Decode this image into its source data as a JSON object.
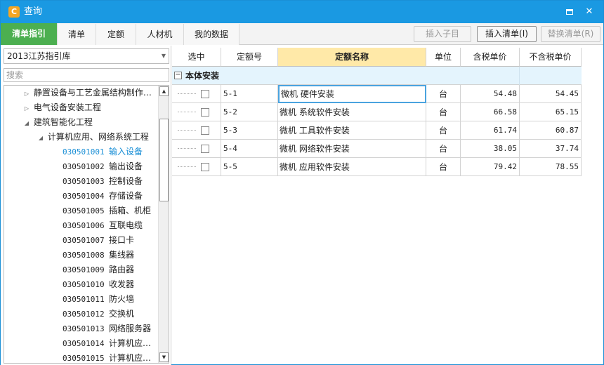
{
  "window": {
    "title": "查询",
    "app_icon_glyph": "C"
  },
  "tabs": [
    {
      "label": "清单指引",
      "active": true
    },
    {
      "label": "清单",
      "active": false
    },
    {
      "label": "定额",
      "active": false
    },
    {
      "label": "人材机",
      "active": false
    },
    {
      "label": "我的数据",
      "active": false
    }
  ],
  "toolbar": {
    "insert_child": "插入子目",
    "insert_list": "插入清单(I)",
    "replace_list": "替换清单(R)"
  },
  "left": {
    "library": "2013江苏指引库",
    "search_placeholder": "搜索",
    "tree": [
      {
        "arrow": "▷",
        "code": "",
        "label": "静置设备与工艺金属结构制作…",
        "selected": false
      },
      {
        "arrow": "▷",
        "code": "",
        "label": "电气设备安装工程",
        "selected": false
      },
      {
        "arrow": "◢",
        "code": "",
        "label": "建筑智能化工程",
        "selected": false
      },
      {
        "arrow": "◢",
        "code": "",
        "label": "计算机应用、网络系统工程",
        "selected": false
      },
      {
        "arrow": "",
        "code": "030501001",
        "label": "输入设备",
        "selected": true
      },
      {
        "arrow": "",
        "code": "030501002",
        "label": "输出设备",
        "selected": false
      },
      {
        "arrow": "",
        "code": "030501003",
        "label": "控制设备",
        "selected": false
      },
      {
        "arrow": "",
        "code": "030501004",
        "label": "存储设备",
        "selected": false
      },
      {
        "arrow": "",
        "code": "030501005",
        "label": "插箱、机柜",
        "selected": false
      },
      {
        "arrow": "",
        "code": "030501006",
        "label": "互联电缆",
        "selected": false
      },
      {
        "arrow": "",
        "code": "030501007",
        "label": "接口卡",
        "selected": false
      },
      {
        "arrow": "",
        "code": "030501008",
        "label": "集线器",
        "selected": false
      },
      {
        "arrow": "",
        "code": "030501009",
        "label": "路由器",
        "selected": false
      },
      {
        "arrow": "",
        "code": "030501010",
        "label": "收发器",
        "selected": false
      },
      {
        "arrow": "",
        "code": "030501011",
        "label": "防火墙",
        "selected": false
      },
      {
        "arrow": "",
        "code": "030501012",
        "label": "交换机",
        "selected": false
      },
      {
        "arrow": "",
        "code": "030501013",
        "label": "网络服务器",
        "selected": false
      },
      {
        "arrow": "",
        "code": "030501014",
        "label": "计算机应…",
        "selected": false
      },
      {
        "arrow": "",
        "code": "030501015",
        "label": "计算机应…",
        "selected": false
      }
    ]
  },
  "grid": {
    "columns": [
      "选中",
      "定额号",
      "定额名称",
      "单位",
      "含税单价",
      "不含税单价"
    ],
    "group_label": "本体安装",
    "rows": [
      {
        "code": "5-1",
        "name": "微机 硬件安装",
        "unit": "台",
        "price_tax": "54.48",
        "price_notax": "54.45"
      },
      {
        "code": "5-2",
        "name": "微机 系统软件安装",
        "unit": "台",
        "price_tax": "66.58",
        "price_notax": "65.15"
      },
      {
        "code": "5-3",
        "name": "微机 工具软件安装",
        "unit": "台",
        "price_tax": "61.74",
        "price_notax": "60.87"
      },
      {
        "code": "5-4",
        "name": "微机 网络软件安装",
        "unit": "台",
        "price_tax": "38.05",
        "price_notax": "37.74"
      },
      {
        "code": "5-5",
        "name": "微机 应用软件安装",
        "unit": "台",
        "price_tax": "79.42",
        "price_notax": "78.55"
      }
    ]
  }
}
